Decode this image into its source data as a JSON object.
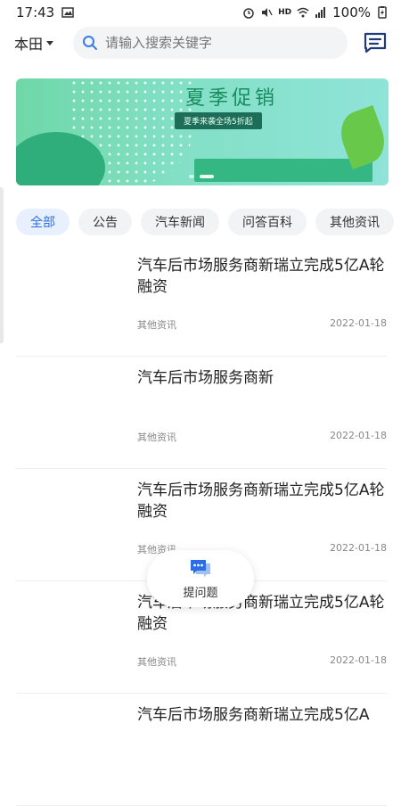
{
  "status_bar": {
    "time": "17:43",
    "network": "HD",
    "battery": "100%"
  },
  "header": {
    "city": "本田",
    "search_placeholder": "请输入搜索关键字"
  },
  "banner": {
    "title": "夏季促销",
    "subtitle": "夏季来袭全场5折起"
  },
  "tabs": [
    "全部",
    "公告",
    "汽车新闻",
    "问答百科",
    "其他资讯"
  ],
  "articles": [
    {
      "title": "汽车后市场服务商新瑞立完成5亿A轮融资",
      "category": "其他资讯",
      "date": "2022-01-18"
    },
    {
      "title": "汽车后市场服务商新",
      "category": "其他资讯",
      "date": "2022-01-18"
    },
    {
      "title": "汽车后市场服务商新瑞立完成5亿A轮融资",
      "category": "其他资讯",
      "date": "2022-01-18"
    },
    {
      "title": "汽车后市场服务商新瑞立完成5亿A轮融资",
      "category": "其他资讯",
      "date": "2022-01-18"
    },
    {
      "title": "汽车后市场服务商新瑞立完成5亿A",
      "category": "",
      "date": ""
    }
  ],
  "ask_button": {
    "label": "提问题"
  },
  "colors": {
    "accent": "#2b6de5",
    "tab_bg": "#f2f3f5"
  }
}
